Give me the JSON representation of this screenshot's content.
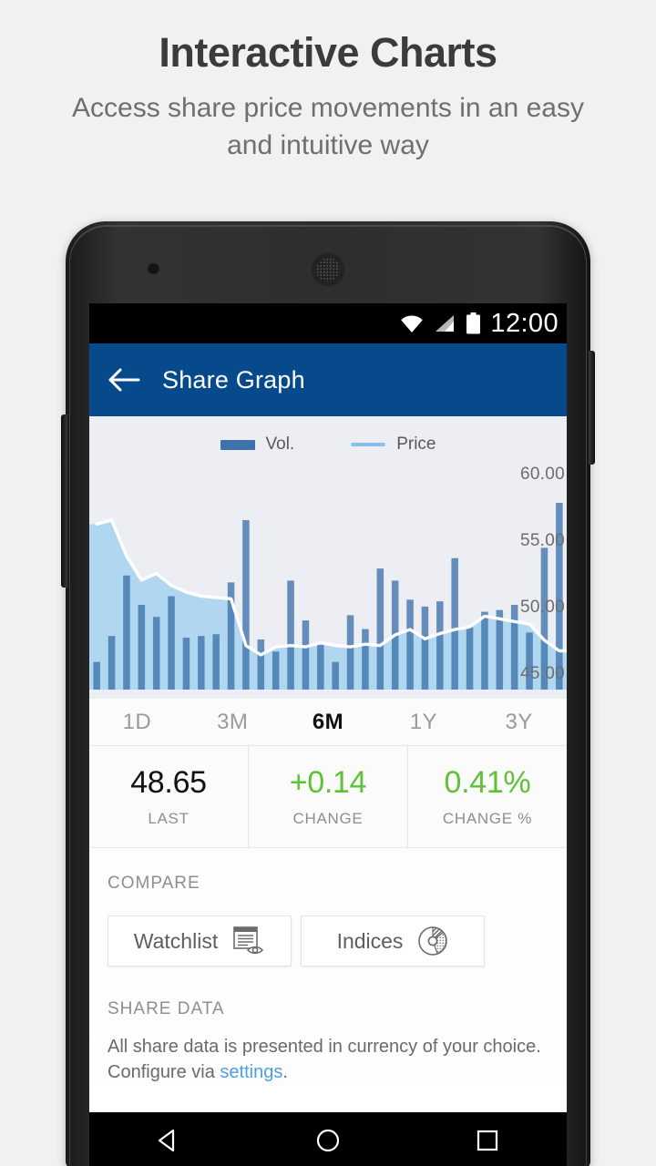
{
  "promo": {
    "title": "Interactive Charts",
    "subtitle": "Access share price movements in an easy and intuitive way"
  },
  "statusbar": {
    "time": "12:00",
    "icons": [
      "wifi-icon",
      "signal-icon",
      "battery-icon"
    ]
  },
  "appbar": {
    "back_icon": "back-arrow-icon",
    "title": "Share Graph",
    "color": "#064a8c"
  },
  "chart_data": {
    "type": "bar",
    "title": "",
    "xlabel": "",
    "ylabel": "",
    "ylim": [
      44.0,
      61.2
    ],
    "grid": false,
    "legend_position": "top-center",
    "legend": [
      {
        "name": "Vol.",
        "color": "#3d72ab",
        "marker": "bar"
      },
      {
        "name": "Price",
        "color": "#86c0e8",
        "marker": "line"
      }
    ],
    "ytick_labels": [
      "60.00",
      "55.00",
      "50.00",
      "45.00"
    ],
    "ytick_values": [
      60.0,
      55.0,
      50.0,
      45.0
    ],
    "categories": [
      "1",
      "2",
      "3",
      "4",
      "5",
      "6",
      "7",
      "8",
      "9",
      "10",
      "11",
      "12",
      "13",
      "14",
      "15",
      "16",
      "17",
      "18",
      "19",
      "20",
      "21",
      "22",
      "23",
      "24",
      "25",
      "26",
      "27",
      "28",
      "29",
      "30",
      "31",
      "32"
    ],
    "series": [
      {
        "name": "Vol.",
        "type": "bar",
        "color": "#3d72ab",
        "values": [
          1.6,
          3.1,
          6.6,
          4.9,
          4.2,
          5.4,
          3.0,
          3.1,
          3.2,
          6.2,
          9.8,
          2.9,
          2.2,
          6.3,
          4.0,
          2.6,
          1.6,
          4.3,
          3.5,
          7.0,
          6.3,
          5.2,
          4.8,
          5.1,
          7.6,
          3.6,
          4.5,
          4.6,
          4.9,
          3.3,
          8.2,
          10.8
        ]
      },
      {
        "name": "Price",
        "type": "line",
        "color": "#86c0e8",
        "values": [
          56.4,
          56.7,
          54.0,
          52.2,
          52.7,
          51.8,
          51.3,
          51.0,
          50.9,
          50.8,
          47.3,
          46.6,
          47.2,
          47.3,
          47.2,
          47.5,
          47.3,
          47.2,
          47.4,
          47.3,
          48.1,
          48.5,
          47.8,
          48.2,
          48.5,
          48.7,
          49.5,
          49.3,
          49.1,
          48.9,
          47.7,
          46.9
        ]
      }
    ]
  },
  "range_tabs": [
    {
      "label": "1D",
      "active": false
    },
    {
      "label": "3M",
      "active": false
    },
    {
      "label": "6M",
      "active": true
    },
    {
      "label": "1Y",
      "active": false
    },
    {
      "label": "3Y",
      "active": false
    }
  ],
  "stats": [
    {
      "value": "48.65",
      "label": "LAST",
      "positive": false
    },
    {
      "value": "+0.14",
      "label": "CHANGE",
      "positive": true
    },
    {
      "value": "0.41%",
      "label": "CHANGE %",
      "positive": true
    }
  ],
  "compare": {
    "heading": "COMPARE",
    "buttons": [
      {
        "label": "Watchlist",
        "icon": "watchlist-eye-icon"
      },
      {
        "label": "Indices",
        "icon": "pie-chart-icon"
      }
    ]
  },
  "share_data": {
    "heading": "SHARE DATA",
    "text_before": "All share data is presented in currency of your choice. Configure via ",
    "link": "settings",
    "text_after": "."
  },
  "navbar": {
    "buttons": [
      "back-triangle-icon",
      "home-circle-icon",
      "recents-square-icon"
    ]
  },
  "colors": {
    "accent": "#064a8c",
    "positive": "#5dc235",
    "bar": "#3d72ab",
    "bar_light": "#6d9fcf",
    "area": "#aed4ee",
    "price_line": "#ffffff",
    "link": "#4e9fe0",
    "chart_bg": "#eceef3"
  }
}
